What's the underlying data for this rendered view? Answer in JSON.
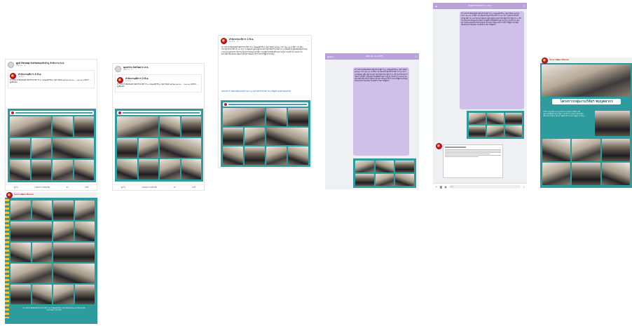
{
  "shot1": {
    "page_name": "ศูนย์ Strong จังหวัดหนองบัวลำภู สำนักงาน ส.ป.",
    "page_meta": "เมื่อวาน · ⚲",
    "post_author": "สำนักงานอธิการ 2 มิ.ย.",
    "post_time": "11 มิ.ย.",
    "post_text": "ข่าวประชาสัมพันธ์สำนักกรรมาธิการ ๒ ในพุฒศุกร์ที่ ๑ กุมภาพันธ์ ๒๕๖๗ ๑๓.๓๐ ... ๑๓.๓๐ นาฬิกา ... ดูเพิ่มเติม",
    "actions": [
      "ถูกใจ",
      "แสดงความคิดเห็น",
      "ส่ง",
      "แชร์"
    ]
  },
  "shot2": {
    "page_name": "คุณธรรม จังหวัดตาก ส.ป.",
    "page_meta": "เมื่อวาน · ⚲",
    "post_author": "สำนักงานอธิการ 2 มิ.ย.",
    "post_time": "11 มิ.ย.",
    "post_text": "ข่าวประชาสัมพันธ์สำนักกรรมาธิการ ๒ ในพุฒศุกร์ที่ ๑ กุมภาพันธ์ ๒๕๖๗ ๑๓.๓๐ ... ๑๓.๓๐ นาฬิกา ... ดูเพิ่มเติม",
    "actions": [
      "ถูกใจ",
      "แสดงความคิดเห็น",
      "ส่ง",
      "แชร์"
    ]
  },
  "shot3": {
    "page_name": "สำนักกรรมาธิการ 2 มิ.ย.",
    "page_meta": "11 มิ.ย. · ⚲",
    "post_text": "ข่าวประชาสัมพันธ์สำนักกรรมาธิการ ๒ ในพุฒศุกร์ที่ ๑ กุมภาพันธ์ ๒๕๖๗ เวลา ๑๓.๓๐ นาฬิกา ณ ห้องประชุมกรรมาธิการ CA 327 นายสุเทพ อู่อ้น ผู้อำนวยการสำนักกรรมาธิการ ๒ พร้อมด้วย ผู้บังคับบัญชากลุ่มงาน และบุคลากร เข้าร่วมโครงการกลุ่มงานวิจัยฯ พบปุคลากรเพื่อสร้างความรู้ ความเข้าใจ และความตระหนักเกี่ยวกับระเบียบว่าด้วยการพัฒนาข้าราชการรัฐสภาสามัญ",
    "hashtags": "#คนสภาร่วมขับเคลื่อนองค์กร Strong #สำนักกรรมาธิการ2 #รัฐสภาองค์กรคุณธรรม"
  },
  "shot4": {
    "topbar_left": "◀ 49+",
    "topbar_title": "ผอก.บก. ๑๘ (Off)",
    "message": "ข่าวประชาสัมพันธ์สำนักกรรมาธิการ ๒ ในพุฒศุกร์ที่ ๑ กุมภาพันธ์ ๒๕๖๗ เวลา ๑๓.๓๐ นาฬิกา ณ ห้องประชุมกรรมาธิการ CA 327 นายสุเทพ อู่อ้น ผู้อำนวยการสำนักกรรมาธิการ ๒ เข้าร่วมโครงการกลุ่มงานวิจัยฯ พบบุคลากรเพื่อสร้างความรู้ ความเข้าใจ และความตระหนักเกี่ยวกับระเบียบว่าด้วยการพัฒนาข้าราชการรัฐสภาสามัญ พร้อมประกาศเจตนารมณ์ข้าราชการรัฐสภา"
  },
  "shot5": {
    "topbar_left": "◀",
    "topbar_title": "สำนักกรรมาธิการ ๒ (OA)",
    "message": "ข่าวประชาสัมพันธ์สำนักกรรมาธิการ ๒ ในพุฒศุกร์ที่ ๑ กุมภาพันธ์ ๒๕๖๗ เวลา ๑๓.๓๐ นาฬิกา ณ ห้องประชุมกรรมาธิการ CA 327 บุคลากรสำนักกรรมาธิการ ๒ นำโดยนายสุเทพ อู่อ้น ผู้อำนวยการสำนักกรรมาธิการ ๒ เข้าร่วมโครงการกลุ่มงานวิจัยฯ พบบุคลากรเพื่อสร้างความรู้ ความเข้าใจ และความตระหนักเกี่ยวกับระเบียบว่าด้วยการพัฒนาข้าราชการรัฐสภาสามัญ พร้อมประกาศเจตนารมณ์ข้าราชการรัฐสภา",
    "input_placeholder": "Aa"
  },
  "shot6": {
    "header_tag": "โครงการพัฒนาจริยธรรม",
    "title": "โครงการกลุ่มงานวิจัยฯ พบบุคลากร",
    "caption": "สำนักกรรมาธิการ ๒ ร่วมโครงการกลุ่มงานวิจัยฯ พบบุคลากรเพื่อสร้างความรู้ ความเข้าใจ และความตระหนักเกี่ยวกับระเบียบว่าด้วยการพัฒนาข้าราชการรัฐสภาสามัญ"
  },
  "shot7": {
    "header_tag": "โครงการพัฒนาจริยธรรม",
    "caption": "ข่าวประชาสัมพันธ์สำนักกรรมาธิการ ๒ ในพุฒศุกร์ที่ ๑ กุมภาพันธ์ ๒๕๖๗ ณ ห้องประชุมกรรมาธิการ CA 327"
  },
  "colors": {
    "teal": "#2e9b9e",
    "line_purple": "#b9a2d8",
    "bubble": "#cfc0ea",
    "brand_red": "#c8102e"
  }
}
